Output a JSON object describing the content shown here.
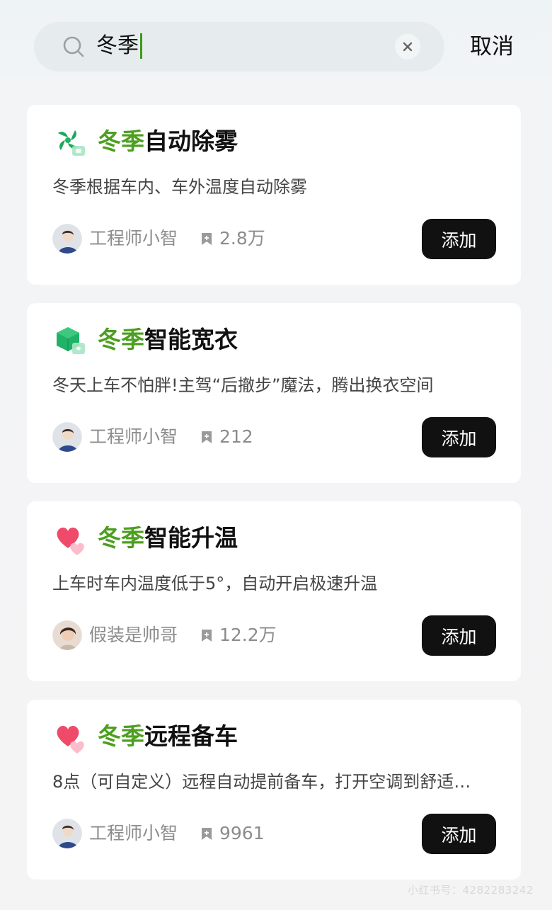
{
  "search": {
    "query": "冬季",
    "cancel_label": "取消"
  },
  "colors": {
    "highlight": "#4c9f1f",
    "button_bg": "#111111"
  },
  "results": [
    {
      "icon": "fan-icon",
      "title_highlight": "冬季",
      "title_rest": "自动除雾",
      "desc": "冬季根据车内、车外温度自动除雾",
      "author": "工程师小智",
      "favorites": "2.8万",
      "add_label": "添加"
    },
    {
      "icon": "cube-icon",
      "title_highlight": "冬季",
      "title_rest": "智能宽衣",
      "desc": "冬天上车不怕胖!主驾“后撤步”魔法，腾出换衣空间",
      "author": "工程师小智",
      "favorites": "212",
      "add_label": "添加"
    },
    {
      "icon": "hearts-icon",
      "title_highlight": "冬季",
      "title_rest": "智能升温",
      "desc": "上车时车内温度低于5°，自动开启极速升温",
      "author": "假装是帅哥",
      "favorites": "12.2万",
      "add_label": "添加"
    },
    {
      "icon": "hearts-icon",
      "title_highlight": "冬季",
      "title_rest": "远程备车",
      "desc": "8点（可自定义）远程自动提前备车，打开空调到舒适…",
      "author": "工程师小智",
      "favorites": "9961",
      "add_label": "添加"
    }
  ],
  "watermark": "小红书号：4282283242"
}
